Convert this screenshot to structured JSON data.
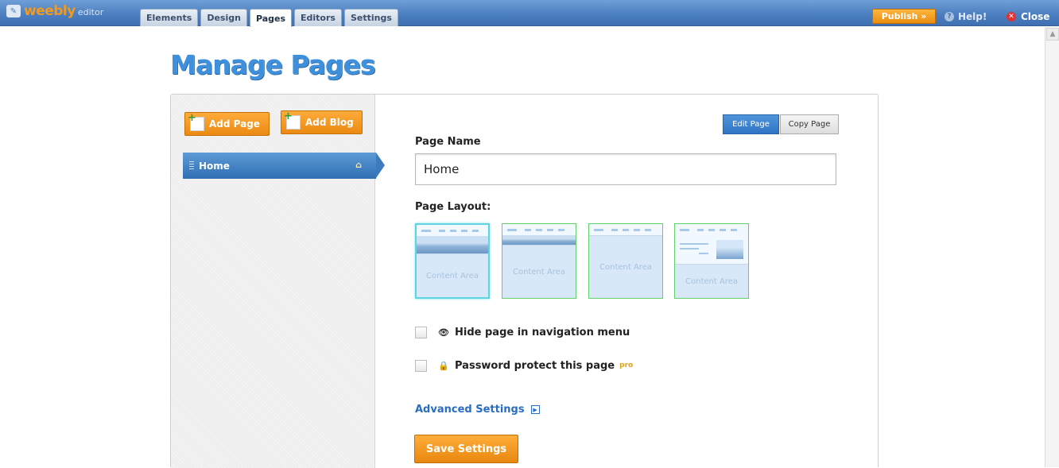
{
  "app": {
    "logo_text": "weebly",
    "logo_sub": "editor"
  },
  "tabs": [
    {
      "label": "Elements"
    },
    {
      "label": "Design"
    },
    {
      "label": "Pages",
      "active": true
    },
    {
      "label": "Editors"
    },
    {
      "label": "Settings"
    }
  ],
  "topbar": {
    "publish_label": "Publish »",
    "help_label": "Help!",
    "close_label": "Close"
  },
  "page": {
    "title": "Manage Pages"
  },
  "sidebar": {
    "add_page_label": "Add Page",
    "add_blog_label": "Add Blog",
    "pages": [
      {
        "label": "Home",
        "is_home": true,
        "selected": true
      }
    ]
  },
  "form": {
    "edit_page_label": "Edit Page",
    "copy_page_label": "Copy Page",
    "page_name_label": "Page Name",
    "page_name_value": "Home",
    "page_layout_label": "Page Layout:",
    "layouts": [
      {
        "content_label": "Content Area",
        "selected": true
      },
      {
        "content_label": "Content Area",
        "selected": false
      },
      {
        "content_label": "Content Area",
        "selected": false
      },
      {
        "content_label": "Content Area",
        "selected": false
      }
    ],
    "hide_nav_label": "Hide page in navigation menu",
    "hide_nav_checked": false,
    "password_label": "Password protect this page",
    "password_checked": false,
    "pro_badge": "pro",
    "advanced_label": "Advanced Settings",
    "save_label": "Save Settings"
  },
  "colors": {
    "brand_orange": "#ea8a13",
    "topbar_blue": "#4a7dbf",
    "selected_blue": "#2f6fb3",
    "title_blue": "#3e8fdc",
    "link_blue": "#2a6dc0"
  },
  "icons": {
    "home": "home-icon",
    "eye": "eye-icon",
    "lock": "lock-icon",
    "help": "help-icon",
    "close": "close-icon"
  }
}
